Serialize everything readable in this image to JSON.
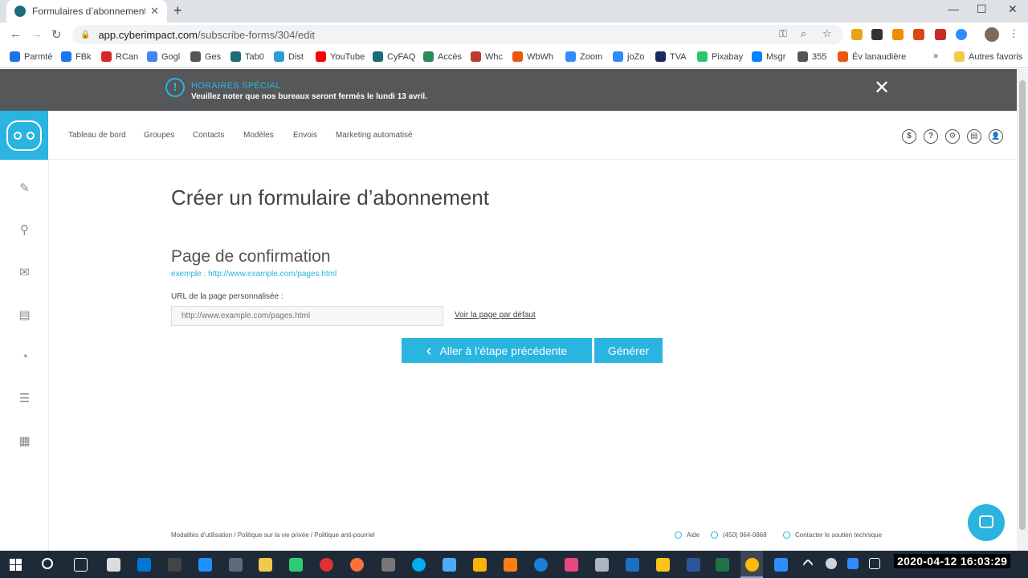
{
  "browser": {
    "tab_title": "Formulaires d’abonnement - Cyb",
    "url_host": "app.cyberimpact.com",
    "url_path": "/subscribe-forms/304/edit",
    "bookmarks": [
      {
        "label": "Parmtė",
        "color": "#1a73e8"
      },
      {
        "label": "FBk",
        "color": "#1877f2"
      },
      {
        "label": "RCan",
        "color": "#d62828"
      },
      {
        "label": "Gogl",
        "color": "#4285f4"
      },
      {
        "label": "Ges",
        "color": "#555555"
      },
      {
        "label": "Tab0",
        "color": "#1d6b7a"
      },
      {
        "label": "Dist",
        "color": "#2a9fd6"
      },
      {
        "label": "YouTube",
        "color": "#ff0000"
      },
      {
        "label": "CyFAQ",
        "color": "#1d6b7a"
      },
      {
        "label": "Accès",
        "color": "#2e8b57"
      },
      {
        "label": "Whc",
        "color": "#c0392b"
      },
      {
        "label": "WbWh",
        "color": "#e8590c"
      },
      {
        "label": "Zoom",
        "color": "#2d8cff"
      },
      {
        "label": "joZo",
        "color": "#2d8cff"
      },
      {
        "label": "TVA",
        "color": "#1a2a5e"
      },
      {
        "label": "Pixabay",
        "color": "#2ec66d"
      },
      {
        "label": "Msgr",
        "color": "#0084ff"
      },
      {
        "label": "355",
        "color": "#555555"
      },
      {
        "label": "Év lanaudière",
        "color": "#e8590c"
      }
    ],
    "bookmarks_more": "»",
    "other_bookmarks": "Autres favoris"
  },
  "banner": {
    "title": "HORAIRES SPÉCIAL",
    "message": "Veuillez noter que nos bureaux seront fermés le lundi 13 avril.",
    "close_glyph": "✕"
  },
  "app": {
    "brand_color": "#2ab4e0",
    "nav": [
      "Tableau de bord",
      "Groupes",
      "Contacts",
      "Modèles",
      "Envois",
      "Marketing automatisé"
    ],
    "header_icons": [
      "$",
      "?",
      "⚙",
      "▤",
      "👤"
    ]
  },
  "page": {
    "title": "Créer un formulaire d’abonnement",
    "section_title": "Page de confirmation",
    "example_label": "exemple : http://www.example.com/pages.html",
    "url_label": "URL de la page personnalisée :",
    "url_placeholder": "http://www.example.com/pages.html",
    "default_page_link": "Voir la page par défaut",
    "prev_button": "Aller à l’étape précédente",
    "generate_button": "Générer"
  },
  "footer": {
    "links": "Modalités d’utilisation / Politique sur la vie privée / Politique anti-pourriel",
    "help": "Aide",
    "phone": "(450) 964-0868",
    "support": "Contacter le soutien technique"
  },
  "taskbar": {
    "clock": "2020-04-12 16:03:29"
  }
}
